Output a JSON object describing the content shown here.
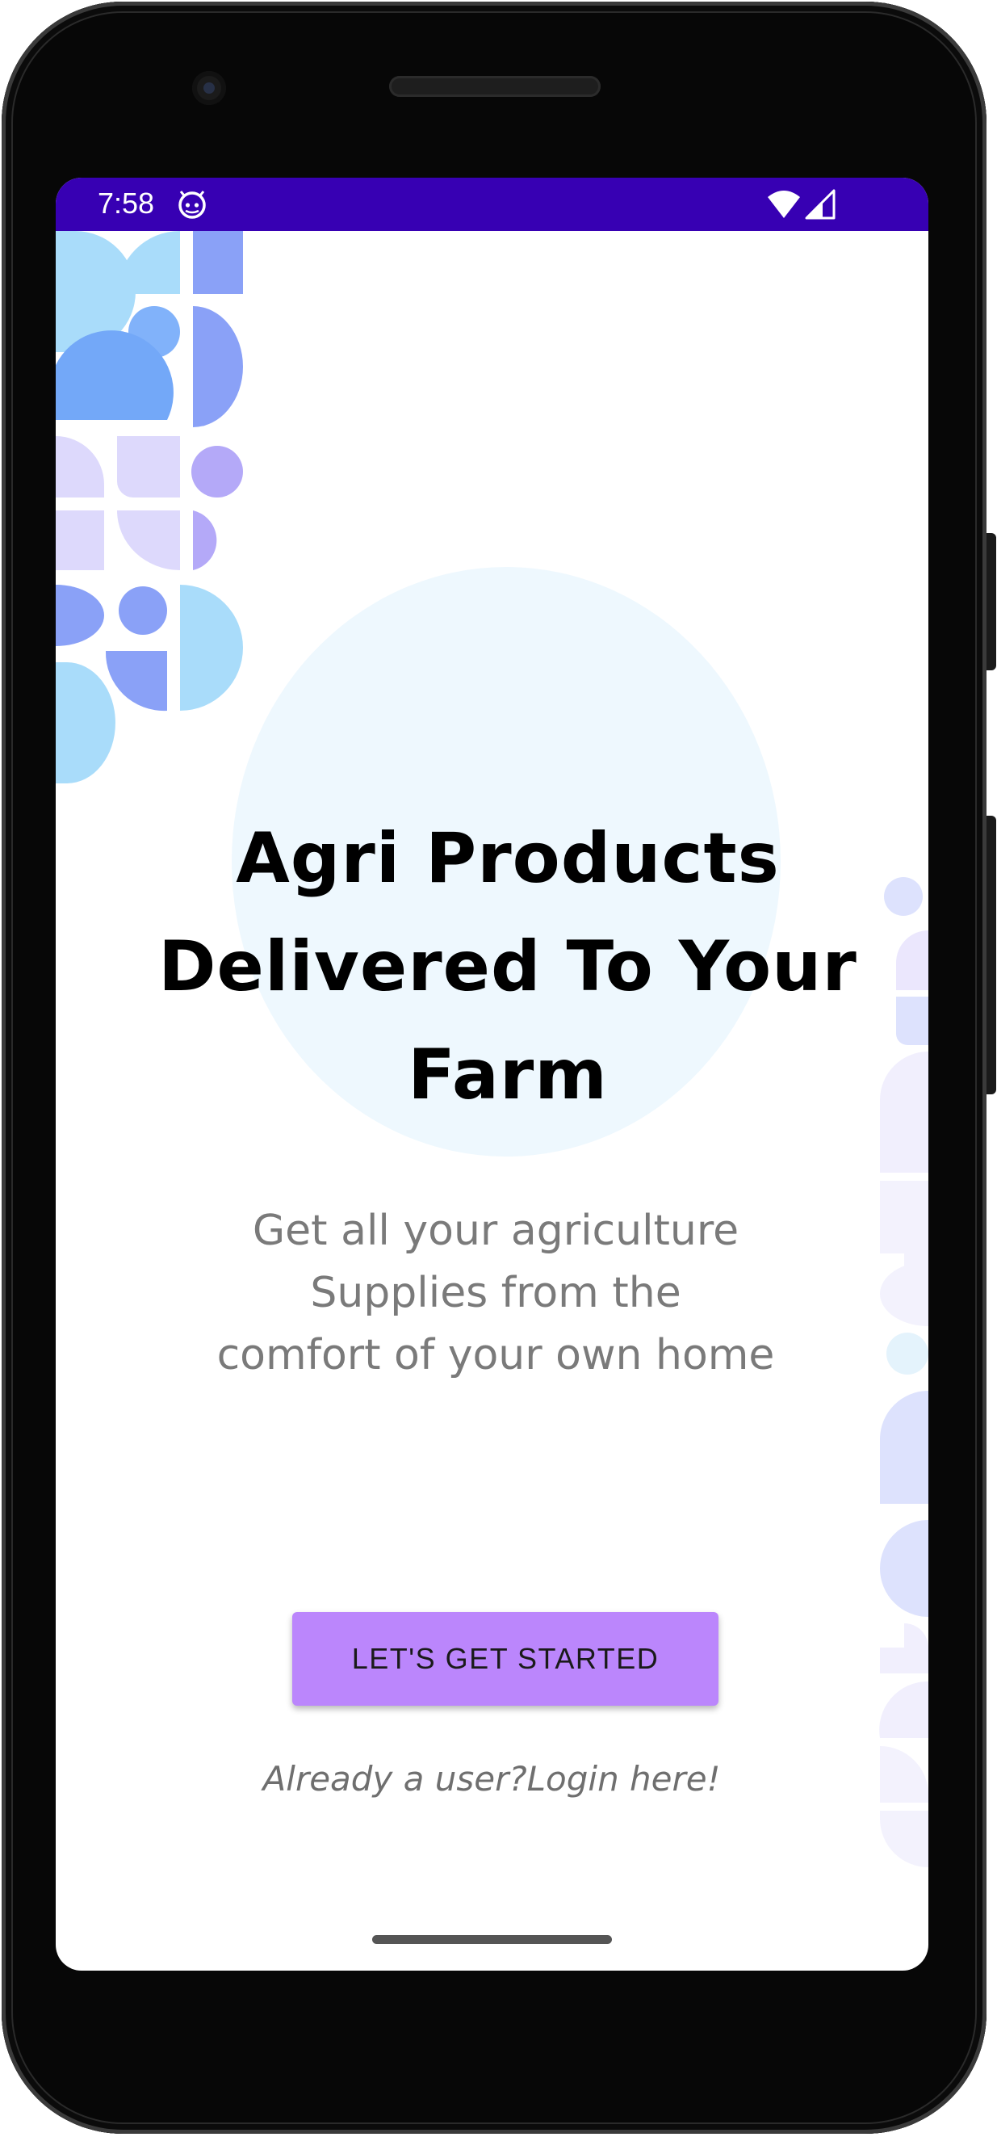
{
  "status_bar": {
    "time": "7:58",
    "app_icon": "android-debug-icon",
    "wifi_icon": "wifi-icon",
    "signal_icon": "cell-signal-icon",
    "color": "#3700b3"
  },
  "onboarding": {
    "headline_line1": "Agri Products",
    "headline_line2": "Delivered To Your",
    "headline_line3": "Farm",
    "subtitle_line1": "Get all your agriculture",
    "subtitle_line2": "Supplies from the",
    "subtitle_line3": "comfort of your own home",
    "cta_label": "LET'S GET STARTED",
    "login_link": "Already a user?Login here!"
  },
  "colors": {
    "button": "#bb86fc",
    "hero_circle": "#eef8fe",
    "subtitle_text": "#7a7a7a"
  }
}
